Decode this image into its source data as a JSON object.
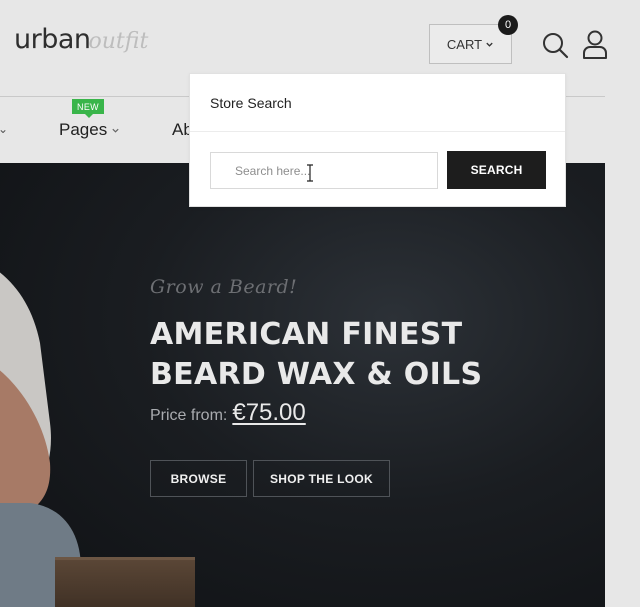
{
  "brand": {
    "name_primary": "urban",
    "name_secondary": "outfit"
  },
  "header": {
    "cart_label": "CART",
    "cart_count": "0",
    "icons": {
      "search": "search-icon",
      "account": "user-icon",
      "cart_chevron": "chevron-down-icon"
    }
  },
  "nav": {
    "items": [
      {
        "label": "Pages",
        "badge": "NEW",
        "has_dropdown": true
      },
      {
        "label": "Ab",
        "has_dropdown": false
      }
    ]
  },
  "search_popup": {
    "title": "Store Search",
    "input_placeholder": "Search here...",
    "input_value": "",
    "submit_label": "SEARCH"
  },
  "hero": {
    "tagline": "Grow a Beard!",
    "headline_line1": "AMERICAN FINEST",
    "headline_line2": "BEARD WAX & OILS",
    "price_label": "Price from:",
    "price_value": "€75.00",
    "buttons": {
      "browse": "BROWSE",
      "shop": "SHOP THE LOOK"
    }
  },
  "colors": {
    "accent_dark": "#1d1d1d",
    "badge_green": "#39b54a",
    "hero_bg": "#1a1d21",
    "page_bg": "#e7e7e7"
  }
}
